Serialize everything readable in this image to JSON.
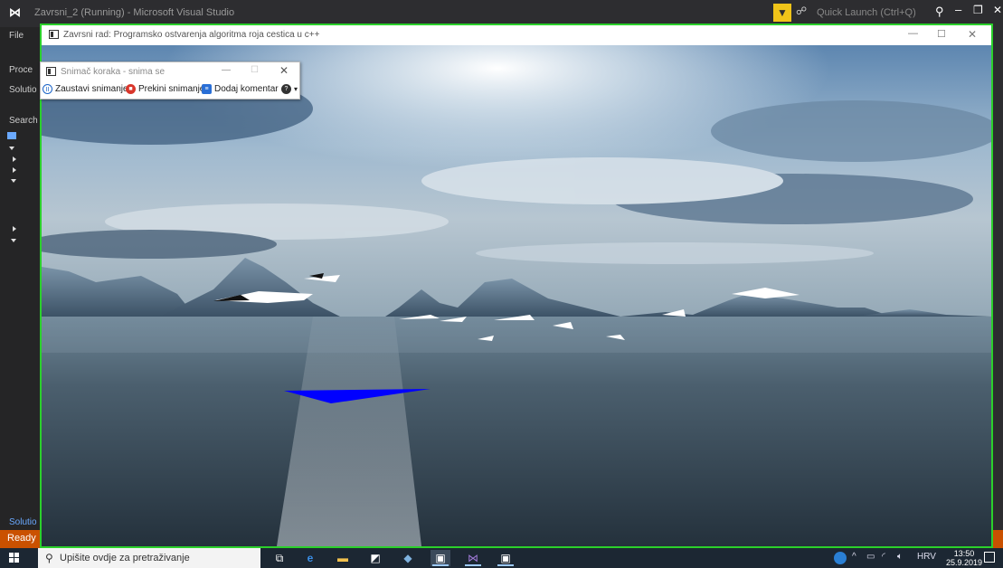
{
  "vs": {
    "title": "Zavrsni_2 (Running) - Microsoft Visual Studio",
    "quick_launch_placeholder": "Quick Launch (Ctrl+Q)",
    "left_items": [
      "File",
      "Proce",
      "Solutio",
      "Search S",
      "Solutio"
    ],
    "status": "Ready"
  },
  "app": {
    "title": "Zavrsni rad: Programsko ostvarenja algoritma roja cestica u c++"
  },
  "recorder": {
    "title": "Snimač koraka - snima se",
    "pause_label": "Zaustavi snimanje",
    "stop_label": "Prekini snimanje",
    "comment_label": "Dodaj komentar"
  },
  "taskbar": {
    "search_placeholder": "Upišite ovdje za pretraživanje",
    "language": "HRV",
    "time": "13:50",
    "date": "25.9.2019"
  },
  "colors": {
    "frame_highlight": "#2bd02b",
    "vs_status": "#ca5100",
    "pyramid": "#0000ff"
  }
}
